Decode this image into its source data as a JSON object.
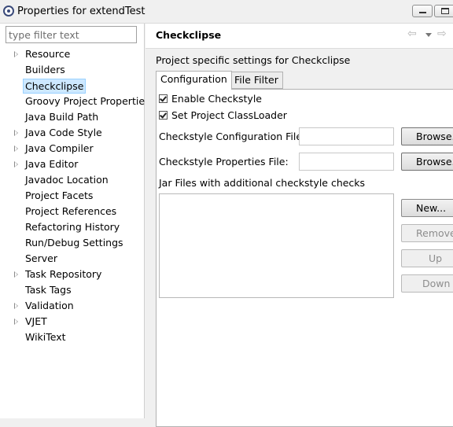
{
  "window": {
    "title": "Properties for extendTest"
  },
  "filter": {
    "placeholder": "type filter text"
  },
  "tree": {
    "items": [
      {
        "label": "Resource",
        "expandable": true
      },
      {
        "label": "Builders",
        "expandable": false
      },
      {
        "label": "Checkclipse",
        "expandable": false,
        "selected": true
      },
      {
        "label": "Groovy Project Properties",
        "expandable": false
      },
      {
        "label": "Java Build Path",
        "expandable": false
      },
      {
        "label": "Java Code Style",
        "expandable": true
      },
      {
        "label": "Java Compiler",
        "expandable": true
      },
      {
        "label": "Java Editor",
        "expandable": true
      },
      {
        "label": "Javadoc Location",
        "expandable": false
      },
      {
        "label": "Project Facets",
        "expandable": false
      },
      {
        "label": "Project References",
        "expandable": false
      },
      {
        "label": "Refactoring History",
        "expandable": false
      },
      {
        "label": "Run/Debug Settings",
        "expandable": false
      },
      {
        "label": "Server",
        "expandable": false
      },
      {
        "label": "Task Repository",
        "expandable": true
      },
      {
        "label": "Task Tags",
        "expandable": false
      },
      {
        "label": "Validation",
        "expandable": true
      },
      {
        "label": "VJET",
        "expandable": true
      },
      {
        "label": "WikiText",
        "expandable": false
      }
    ]
  },
  "page": {
    "title": "Checkclipse",
    "description": "Project specific settings for Checkclipse"
  },
  "tabs": [
    {
      "label": "Configuration",
      "active": true
    },
    {
      "label": "File Filter",
      "active": false
    }
  ],
  "config": {
    "enable_checkstyle": {
      "label": "Enable Checkstyle",
      "checked": true
    },
    "set_classloader": {
      "label": "Set Project ClassLoader",
      "checked": true
    },
    "config_file_label": "Checkstyle Configuration File:",
    "config_file_value": "",
    "properties_file_label": "Checkstyle Properties File:",
    "properties_file_value": "",
    "browse_label": "Browse...",
    "jar_files_label": "Jar Files with additional checkstyle checks",
    "new_label": "New...",
    "remove_label": "Remove",
    "up_label": "Up",
    "down_label": "Down"
  }
}
